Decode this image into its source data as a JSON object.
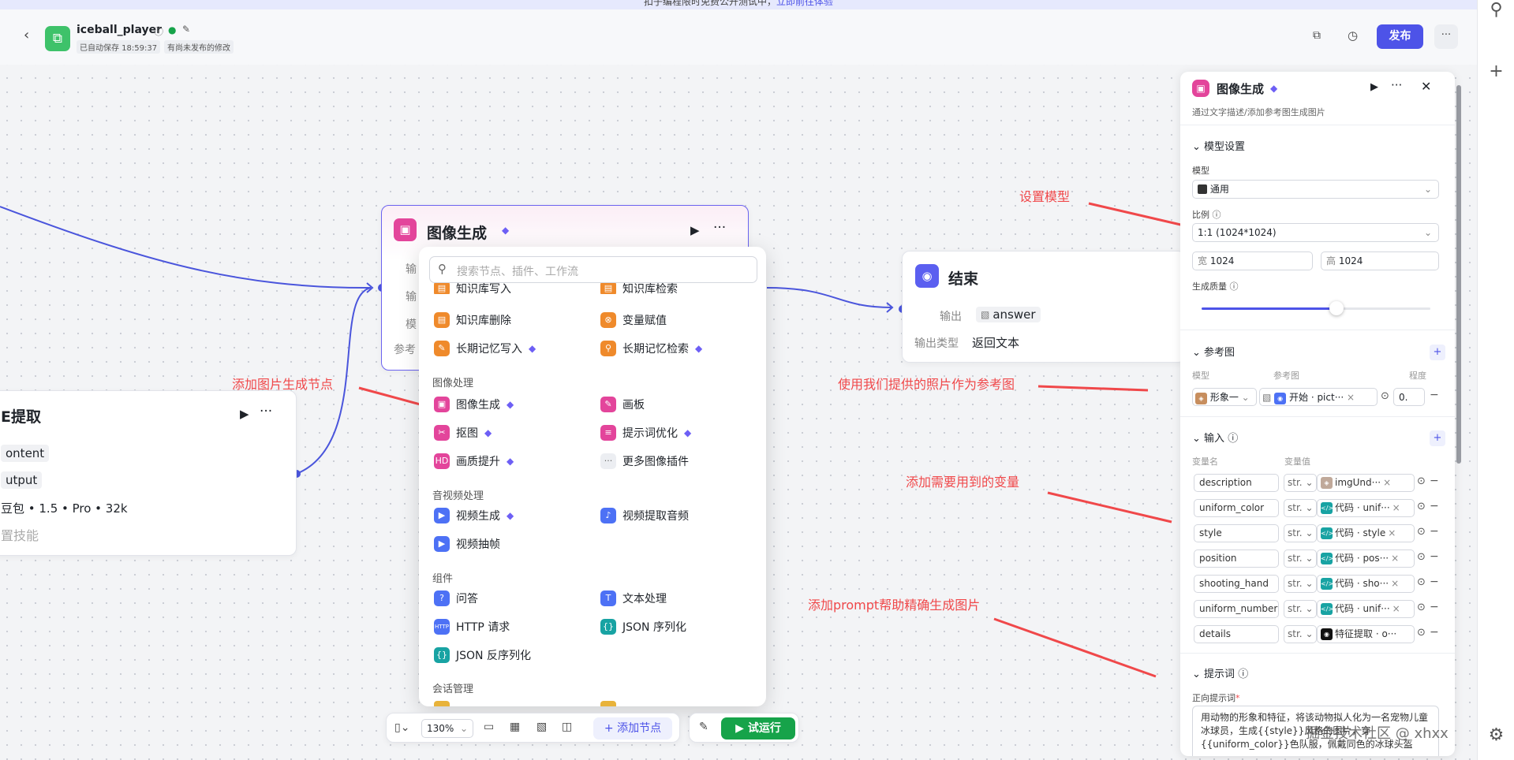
{
  "banner": {
    "text": "扣子编程限时免费公开测试中，",
    "link": "立即前往体验"
  },
  "header": {
    "app_name": "iceball_player",
    "autosave": "已自动保存 18:59:37",
    "unpublished": "有尚未发布的修改",
    "publish": "发布"
  },
  "colors": {
    "accent": "#4d53e8",
    "edge": "#4a55dc",
    "annotation": "#f0484a",
    "pink": "#e3459b",
    "green": "#16a34a"
  },
  "canvas": {
    "left_node": {
      "title": "E提取",
      "row1": "ontent",
      "row2": "utput",
      "model_info": "豆包 • 1.5 • Pro • 32k",
      "skill": "置技能"
    },
    "img_node": {
      "title": "图像生成",
      "row_labels": [
        "输",
        "输",
        "模",
        "参考"
      ]
    },
    "end_node": {
      "title": "结束",
      "out_label": "输出",
      "out_value": "answer",
      "type_label": "输出类型",
      "type_value": "返回文本"
    }
  },
  "popup": {
    "search_placeholder": "搜索节点、插件、工作流",
    "top_items": [
      "知识库写入",
      "知识库检索",
      "知识库删除",
      "变量赋值",
      "长期记忆写入",
      "长期记忆检索"
    ],
    "sections": [
      {
        "title": "图像处理",
        "items": [
          "图像生成",
          "画板",
          "抠图",
          "提示词优化",
          "画质提升",
          "更多图像插件"
        ]
      },
      {
        "title": "音视频处理",
        "items": [
          "视频生成",
          "视频提取音频",
          "视频抽帧"
        ]
      },
      {
        "title": "组件",
        "items": [
          "问答",
          "文本处理",
          "HTTP 请求",
          "JSON 序列化",
          "JSON 反序列化"
        ]
      },
      {
        "title": "会话管理",
        "items": []
      }
    ]
  },
  "annotations": {
    "set_model": "设置模型",
    "add_node": "添加图片生成节点",
    "ref_image": "使用我们提供的照片作为参考图",
    "add_vars": "添加需要用到的变量",
    "add_prompt": "添加prompt帮助精确生成图片"
  },
  "panel": {
    "title": "图像生成",
    "desc": "通过文字描述/添加参考图生成图片",
    "model_section": "模型设置",
    "model_label": "模型",
    "model_value": "通用",
    "ratio_label": "比例",
    "ratio_value": "1:1 (1024*1024)",
    "width_label": "宽",
    "width": "1024",
    "height_label": "高",
    "height": "1024",
    "quality_label": "生成质量",
    "quality_level": 0.59,
    "ref_section": "参考图",
    "ref_col_model": "模型",
    "ref_col_image": "参考图",
    "ref_col_degree": "程度",
    "ref_model": "形象一",
    "ref_image": "开始 · pict···",
    "ref_degree": "0.",
    "input_section": "输入",
    "col_name": "变量名",
    "col_value": "变量值",
    "inputs": [
      {
        "name": "description",
        "type": "str.",
        "ref": "imgUnd···"
      },
      {
        "name": "uniform_color",
        "type": "str.",
        "ref": "代码 · unif···"
      },
      {
        "name": "style",
        "type": "str.",
        "ref": "代码 · style"
      },
      {
        "name": "position",
        "type": "str.",
        "ref": "代码 · pos···"
      },
      {
        "name": "shooting_hand",
        "type": "str.",
        "ref": "代码 · sho···"
      },
      {
        "name": "uniform_number",
        "type": "str.",
        "ref": "代码 · unif···"
      },
      {
        "name": "details",
        "type": "str.",
        "ref": "特征提取 · o···"
      }
    ],
    "prompt_section": "提示词",
    "prompt_label": "正向提示词",
    "prompt_text": "用动物的形象和特征，将该动物拟人化为一名宠物儿童冰球员，生成{{style}}风格的图片，穿{{uniform_color}}色队服，佩戴同色的冰球头盔",
    "watermark": "掘金技术社区 @ xhxx"
  },
  "toolbar": {
    "zoom": "130%",
    "add_node": "添加节点",
    "run": "试运行"
  }
}
